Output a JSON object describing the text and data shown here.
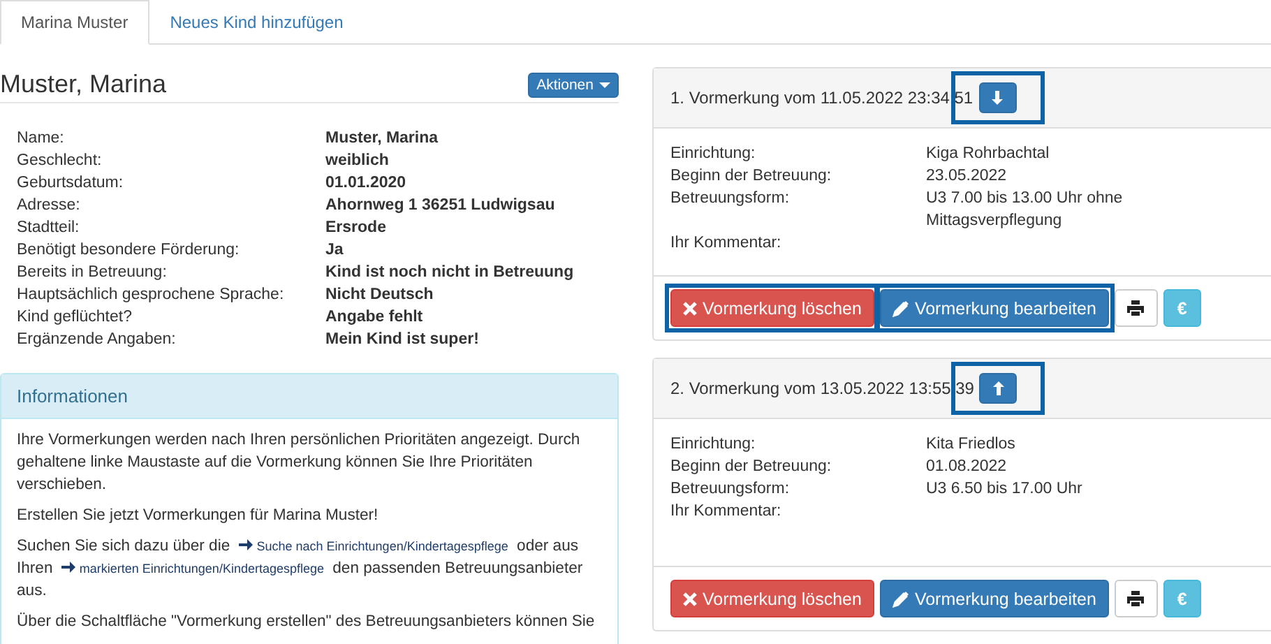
{
  "tabs": [
    {
      "label": "Marina Muster",
      "selected": true
    },
    {
      "label": "Neues Kind hinzufügen",
      "selected": false
    }
  ],
  "child": {
    "heading": "Muster, Marina",
    "actions_button": "Aktionen",
    "details": [
      {
        "label": "Name:",
        "value": "Muster, Marina"
      },
      {
        "label": "Geschlecht:",
        "value": "weiblich"
      },
      {
        "label": "Geburtsdatum:",
        "value": "01.01.2020"
      },
      {
        "label": "Adresse:",
        "value": "Ahornweg 1 36251 Ludwigsau"
      },
      {
        "label": "Stadtteil:",
        "value": "Ersrode"
      },
      {
        "label": "Benötigt besondere Förderung:",
        "value": "Ja"
      },
      {
        "label": "Bereits in Betreuung:",
        "value": "Kind ist noch nicht in Betreuung"
      },
      {
        "label": "Hauptsächlich gesprochene Sprache:",
        "value": "Nicht Deutsch"
      },
      {
        "label": "Kind geflüchtet?",
        "value": "Angabe fehlt"
      },
      {
        "label": "Ergänzende Angaben:",
        "value": "Mein Kind ist super!"
      }
    ]
  },
  "info_panel": {
    "title": "Informationen",
    "paragraphs": [
      [
        {
          "kind": "text",
          "text": "Ihre Vormerkungen werden nach Ihren persönlichen Prioritäten angezeigt. Durch gehaltene linke Maustaste auf die Vormerkung können Sie Ihre Prioritäten verschieben."
        }
      ],
      [
        {
          "kind": "text",
          "text": "Erstellen Sie jetzt Vormerkungen für Marina Muster!"
        }
      ],
      [
        {
          "kind": "text",
          "text": "Suchen Sie sich dazu über die"
        },
        {
          "kind": "link",
          "text": "Suche nach Einrichtungen/Kindertagespflege"
        },
        {
          "kind": "text",
          "text": "oder aus Ihren"
        },
        {
          "kind": "link",
          "text": "markierten Einrichtungen/Kindertagespflege"
        },
        {
          "kind": "text",
          "text": "den passenden Betreuungsanbieter aus."
        }
      ],
      [
        {
          "kind": "text",
          "text": "Über die Schaltfläche \"Vormerkung erstellen\" des Betreuungsanbieters können Sie"
        }
      ]
    ]
  },
  "reservations": [
    {
      "title": "1. Vormerkung vom 11.05.2022 23:34:51",
      "move_down": true,
      "move_highlighted": true,
      "fields": [
        {
          "label": "Einrichtung:",
          "value": "Kiga Rohrbachtal"
        },
        {
          "label": "Beginn der Betreuung:",
          "value": "23.05.2022"
        },
        {
          "label": "Betreuungsform:",
          "value": "U3 7.00 bis 13.00 Uhr ohne Mittagsverpflegung"
        },
        {
          "label": "Ihr Kommentar:"
        }
      ],
      "delete_button": {
        "label": "Vormerkung löschen",
        "highlighted": true
      },
      "edit_button": {
        "label": "Vormerkung bearbeiten",
        "highlighted": true
      },
      "fee_button": "€"
    },
    {
      "title": "2. Vormerkung vom 13.05.2022 13:55:39",
      "move_down": false,
      "move_highlighted": true,
      "fields": [
        {
          "label": "Einrichtung:",
          "value": "Kita Friedlos"
        },
        {
          "label": "Beginn der Betreuung:",
          "value": "01.08.2022"
        },
        {
          "label": "Betreuungsform:",
          "value": "U3 6.50 bis 17.00 Uhr"
        },
        {
          "label": "Ihr Kommentar:"
        }
      ],
      "delete_button": {
        "label": "Vormerkung löschen",
        "highlighted": false
      },
      "edit_button": {
        "label": "Vormerkung bearbeiten",
        "highlighted": false
      },
      "fee_button": "€"
    }
  ]
}
